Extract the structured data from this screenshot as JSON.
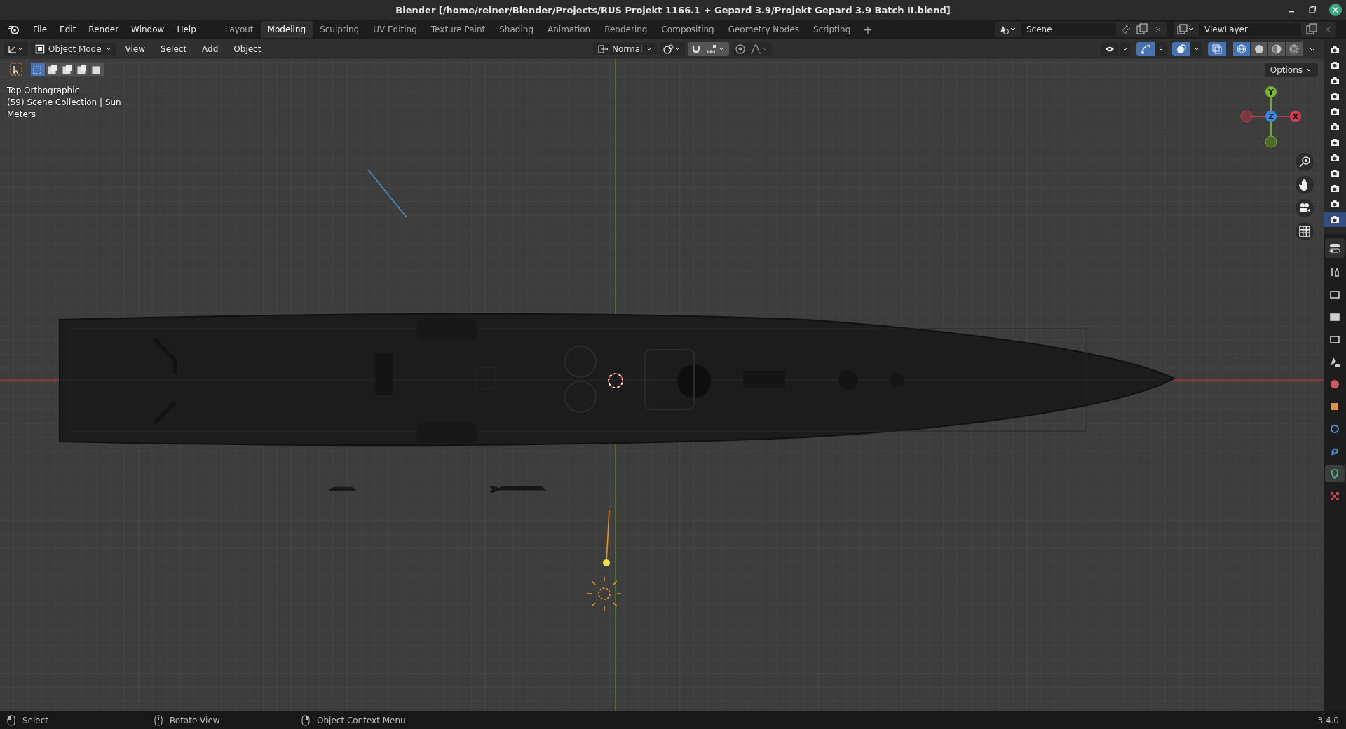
{
  "window": {
    "title": "Blender [/home/reiner/Blender/Projects/RUS Projekt 1166.1 + Gepard 3.9/Projekt Gepard 3.9 Batch II.blend]"
  },
  "menu": [
    "File",
    "Edit",
    "Render",
    "Window",
    "Help"
  ],
  "workspaces": [
    {
      "label": "Layout",
      "selected": false
    },
    {
      "label": "Modeling",
      "selected": true
    },
    {
      "label": "Sculpting",
      "selected": false
    },
    {
      "label": "UV Editing",
      "selected": false
    },
    {
      "label": "Texture Paint",
      "selected": false
    },
    {
      "label": "Shading",
      "selected": false
    },
    {
      "label": "Animation",
      "selected": false
    },
    {
      "label": "Rendering",
      "selected": false
    },
    {
      "label": "Compositing",
      "selected": false
    },
    {
      "label": "Geometry Nodes",
      "selected": false
    },
    {
      "label": "Scripting",
      "selected": false
    }
  ],
  "add_workspace": "+",
  "scene": {
    "value": "Scene"
  },
  "view_layer": {
    "value": "ViewLayer"
  },
  "viewport_header": {
    "mode": "Object Mode",
    "menus": [
      "View",
      "Select",
      "Add",
      "Object"
    ],
    "orientation": "Normal",
    "toggles": [
      {
        "kind": "snap",
        "on": true
      },
      {
        "kind": "proportional",
        "on": false
      }
    ],
    "overlay_toggles": [
      {
        "kind": "visibility",
        "on": false
      },
      {
        "kind": "gizmo",
        "on": true
      },
      {
        "kind": "overlays",
        "on": true
      },
      {
        "kind": "xray",
        "on": true
      }
    ],
    "shading": [
      {
        "kind": "wireframe",
        "selected": true
      },
      {
        "kind": "solid",
        "selected": false
      },
      {
        "kind": "material",
        "selected": false
      },
      {
        "kind": "rendered",
        "selected": false
      }
    ]
  },
  "select_modes": [
    {
      "selected": true
    },
    {
      "selected": false
    },
    {
      "selected": false
    },
    {
      "selected": false
    },
    {
      "selected": false
    }
  ],
  "overlay_text": [
    "Top Orthographic",
    "(59) Scene Collection | Sun",
    "Meters"
  ],
  "options": "Options",
  "gizmo": {
    "x": "X",
    "y": "Y",
    "z": "Z"
  },
  "outliner_rows": [
    {
      "selected": false
    },
    {
      "selected": false
    },
    {
      "selected": false
    },
    {
      "selected": false
    },
    {
      "selected": false
    },
    {
      "selected": false
    },
    {
      "selected": false
    },
    {
      "selected": false
    },
    {
      "selected": false
    },
    {
      "selected": false
    },
    {
      "selected": false
    },
    {
      "selected": true
    }
  ],
  "property_tabs": [
    {
      "kind": "tool",
      "selected": false
    },
    {
      "kind": "render",
      "selected": false
    },
    {
      "kind": "output",
      "selected": false
    },
    {
      "kind": "view",
      "selected": false
    },
    {
      "kind": "scene",
      "selected": false
    },
    {
      "kind": "world",
      "selected": false
    },
    {
      "kind": "object",
      "selected": false
    },
    {
      "kind": "physics",
      "selected": false
    },
    {
      "kind": "constraints",
      "selected": false
    },
    {
      "kind": "light",
      "selected": true
    },
    {
      "kind": "texture",
      "selected": false
    }
  ],
  "status_bar": {
    "hints": [
      {
        "kind": "left",
        "label": "Select"
      },
      {
        "kind": "middle",
        "label": "Rotate View"
      },
      {
        "kind": "right",
        "label": "Object Context Menu"
      }
    ],
    "version": "3.4.0"
  }
}
